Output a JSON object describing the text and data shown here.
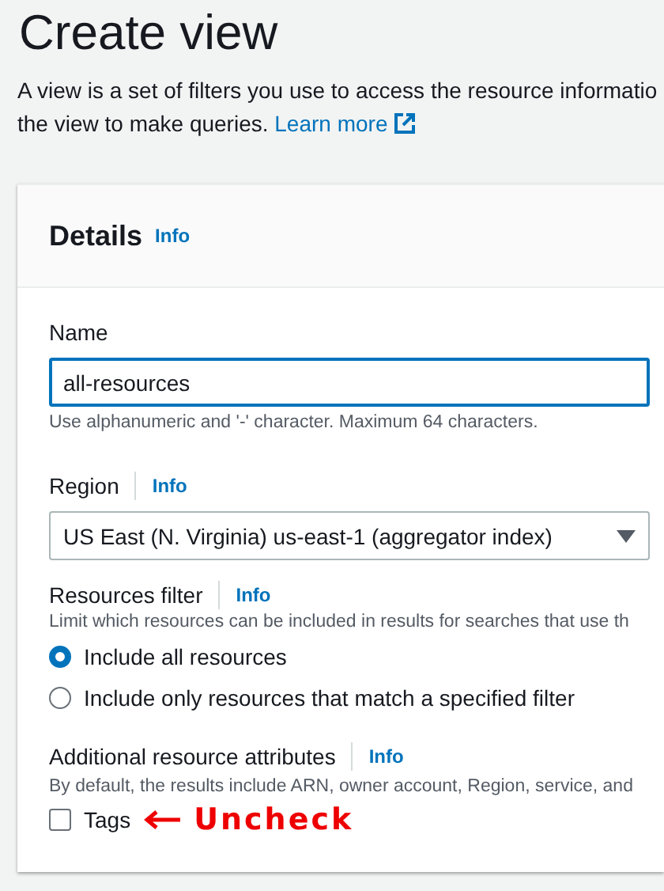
{
  "page": {
    "title": "Create view",
    "description_line_1": "A view is a set of filters you use to access the resource informatio",
    "description_line_2": "the view to make queries.",
    "learn_more": "Learn more"
  },
  "details": {
    "title": "Details",
    "info": "Info",
    "name_field": {
      "label": "Name",
      "value": "all-resources",
      "hint": "Use alphanumeric and '-' character. Maximum 64 characters."
    },
    "region_field": {
      "label": "Region",
      "info": "Info",
      "value": "US East (N. Virginia) us-east-1 (aggregator index)"
    },
    "resources_filter": {
      "label": "Resources filter",
      "info": "Info",
      "description": "Limit which resources can be included in results for searches that use th",
      "options": [
        {
          "label": "Include all resources",
          "selected": true
        },
        {
          "label": "Include only resources that match a specified filter",
          "selected": false
        }
      ]
    },
    "additional_attributes": {
      "label": "Additional resource attributes",
      "info": "Info",
      "description": "By default, the results include ARN, owner account, Region, service, and",
      "tags": {
        "label": "Tags",
        "checked": false
      },
      "annotation": "Uncheck"
    }
  }
}
